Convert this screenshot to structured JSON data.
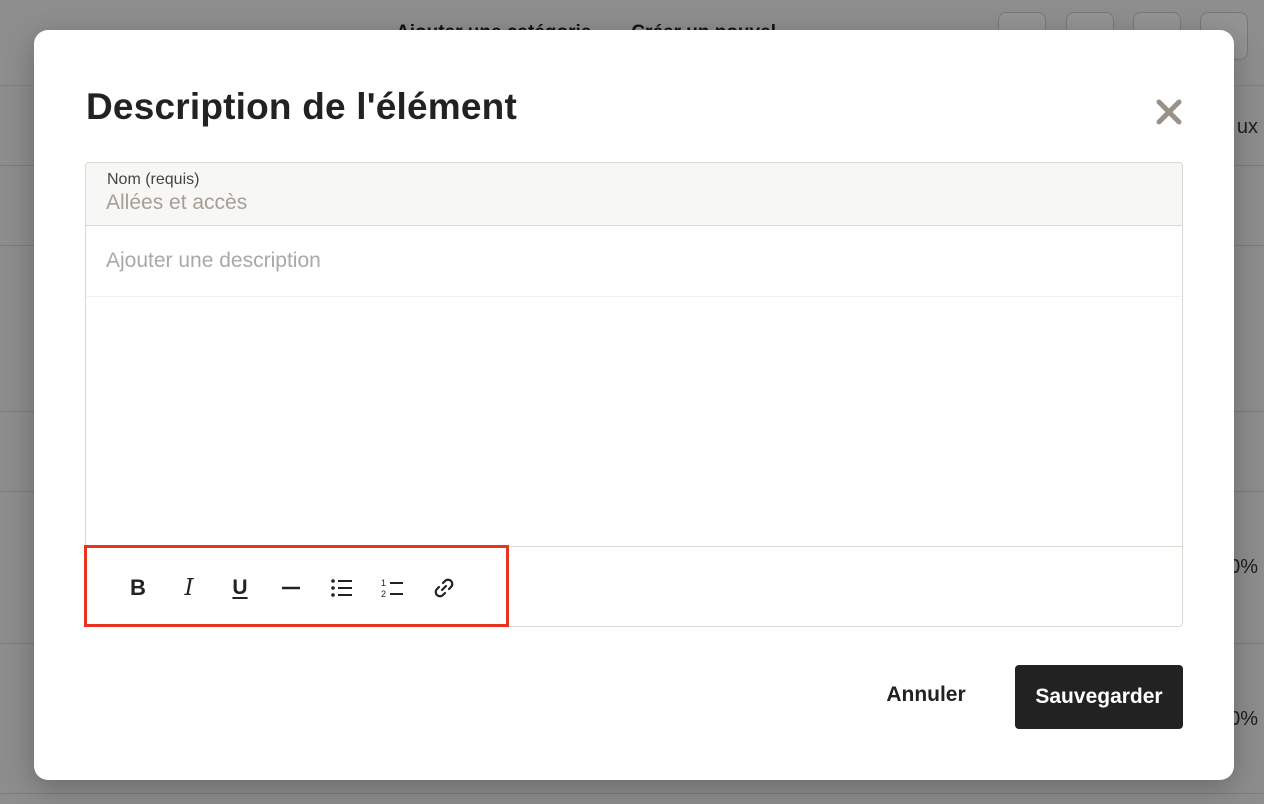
{
  "background": {
    "tabs": [
      "Ajouter une catégorie",
      "Créer un nouvel"
    ],
    "right_column_fragments": [
      "ux",
      "0%",
      "0%"
    ]
  },
  "modal": {
    "title": "Description de l'élément",
    "name_field": {
      "label": "Nom (requis)",
      "value": "Allées et accès"
    },
    "description": {
      "placeholder": "Ajouter une description"
    },
    "toolbar": {
      "bold": "B",
      "italic": "I",
      "underline": "U",
      "icons": [
        "bold-icon",
        "italic-icon",
        "underline-icon",
        "horizontal-rule-icon",
        "bullet-list-icon",
        "numbered-list-icon",
        "link-icon"
      ]
    },
    "cancel_label": "Annuler",
    "save_label": "Sauvegarder"
  },
  "colors": {
    "highlight": "#e8341f",
    "primary_button": "#222222",
    "name_value": "#a79f94"
  }
}
